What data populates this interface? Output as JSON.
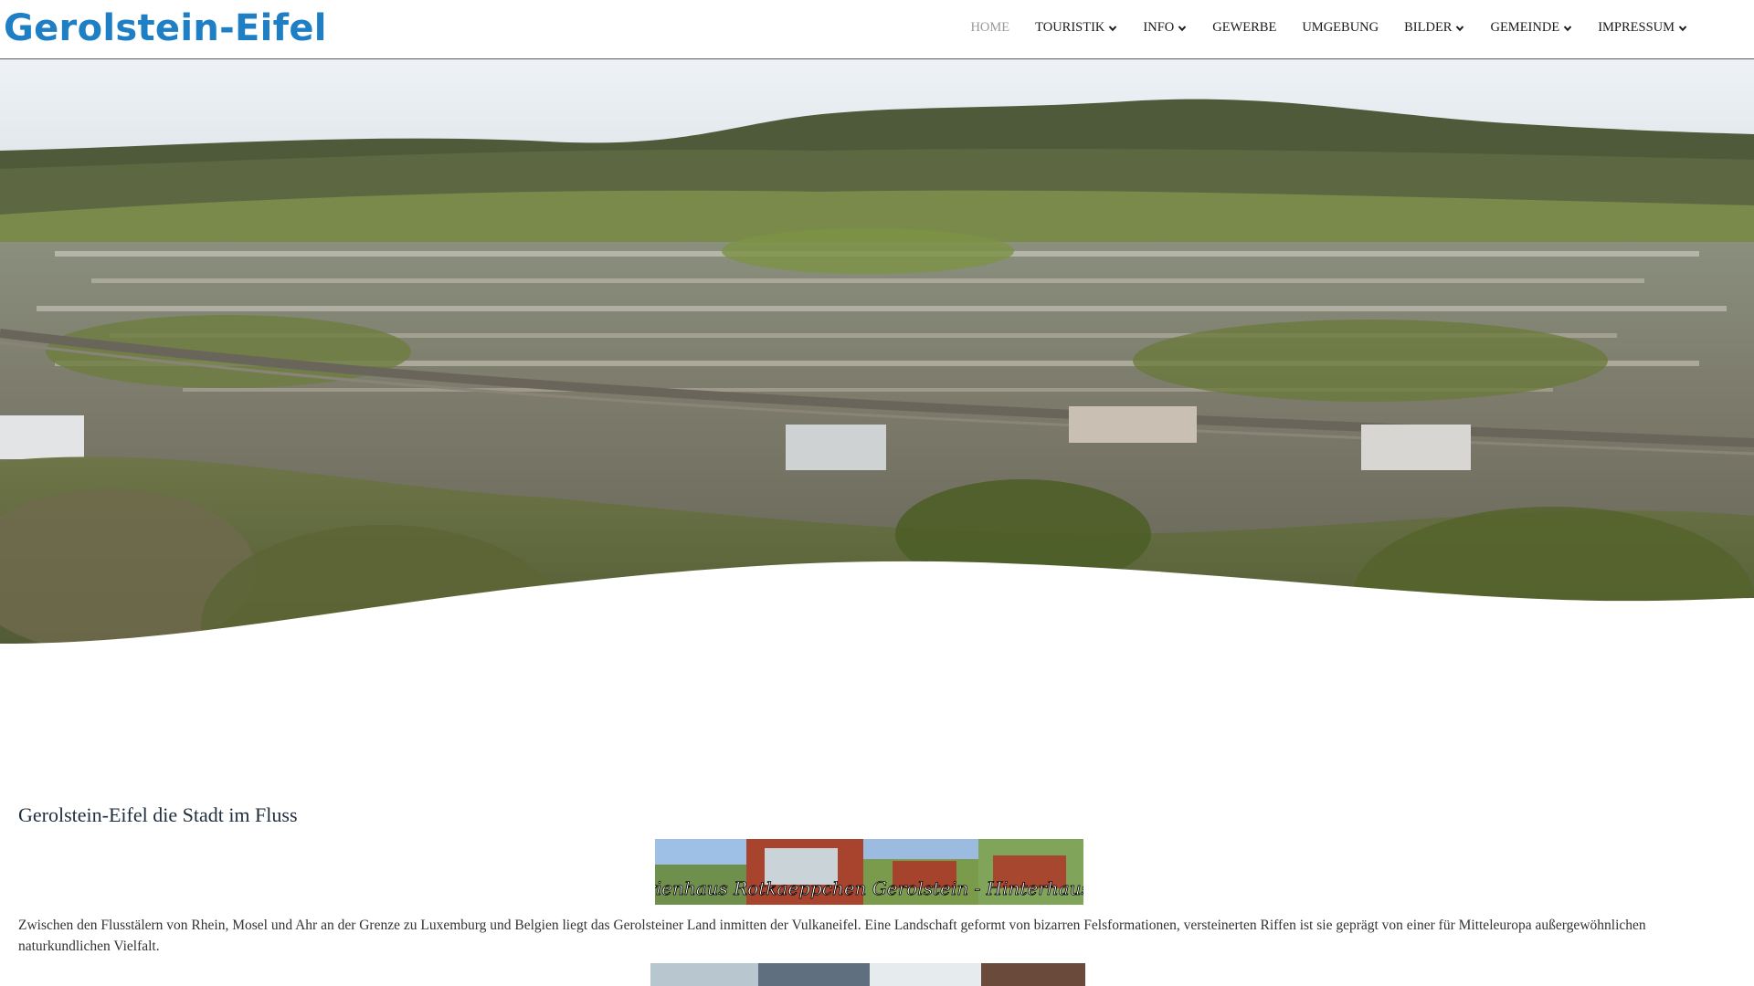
{
  "site": {
    "logo_text": "Gerolstein-Eifel"
  },
  "nav": {
    "items": [
      {
        "label": "HOME",
        "active": true,
        "has_dropdown": false
      },
      {
        "label": "TOURISTIK",
        "active": false,
        "has_dropdown": true
      },
      {
        "label": "INFO",
        "active": false,
        "has_dropdown": true
      },
      {
        "label": "GEWERBE",
        "active": false,
        "has_dropdown": false
      },
      {
        "label": "UMGEBUNG",
        "active": false,
        "has_dropdown": false
      },
      {
        "label": "BILDER",
        "active": false,
        "has_dropdown": true
      },
      {
        "label": "GEMEINDE",
        "active": false,
        "has_dropdown": true
      },
      {
        "label": "IMPRESSUM",
        "active": false,
        "has_dropdown": true
      }
    ]
  },
  "main": {
    "title": "Gerolstein-Eifel die Stadt im Fluss",
    "banner_text": "Ferienhaus Rotkaeppchen Gerolstein - Hinterhausen",
    "paragraph": "Zwischen den Flusstälern von Rhein, Mosel und Ahr an der Grenze zu Luxemburg und Belgien liegt das Gerolsteiner Land inmitten der Vulkaneifel. Eine Landschaft geformt von bizarren Felsformationen, versteinerten Riffen ist sie geprägt von einer für Mitteleuropa außergewöhnlichen naturkundlichen Vielfalt."
  },
  "colors": {
    "logo": "#1e7fc4",
    "nav_text": "#1a1a1a",
    "nav_active": "#9a9a9a",
    "title": "#1f2e3d",
    "text": "#333333"
  },
  "icons": {
    "dropdown": "chevron-down-icon"
  }
}
